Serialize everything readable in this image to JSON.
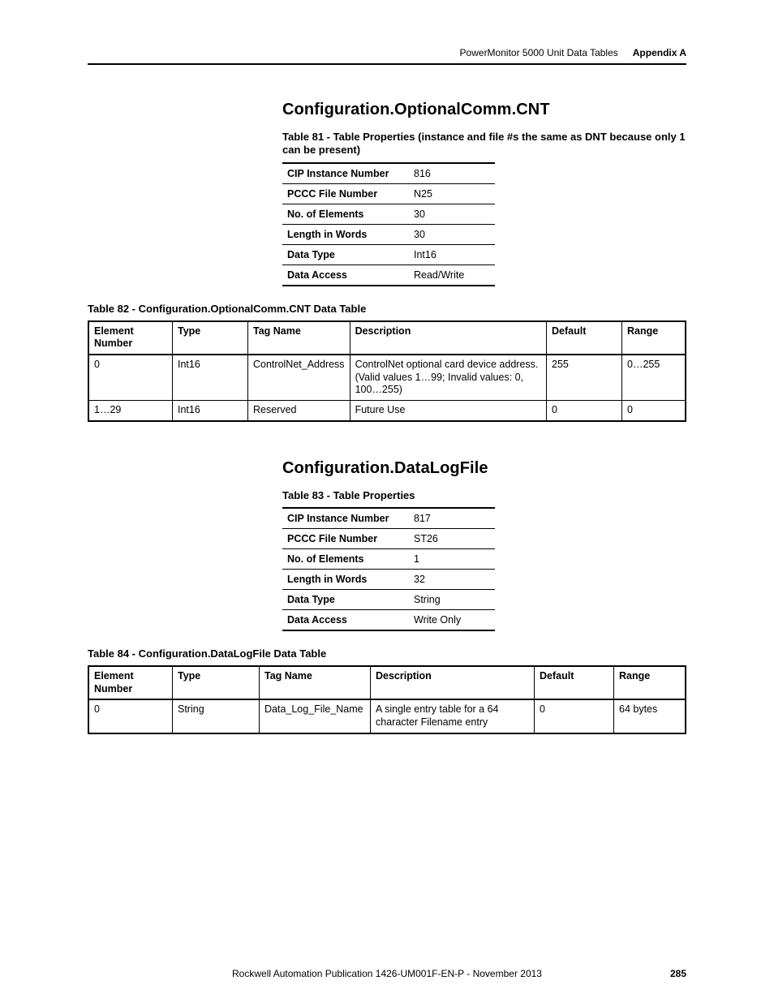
{
  "running_head": {
    "title": "PowerMonitor 5000 Unit Data Tables",
    "appendix": "Appendix A"
  },
  "section1": {
    "title": "Configuration.OptionalComm.CNT",
    "props_caption": "Table 81 - Table Properties (instance and file #s the same as DNT because only 1 can be present)",
    "props": [
      {
        "label": "CIP Instance Number",
        "value": "816"
      },
      {
        "label": "PCCC File Number",
        "value": "N25"
      },
      {
        "label": "No. of Elements",
        "value": "30"
      },
      {
        "label": "Length in Words",
        "value": "30"
      },
      {
        "label": "Data Type",
        "value": "Int16"
      },
      {
        "label": "Data Access",
        "value": "Read/Write"
      }
    ],
    "data_caption": "Table 82 - Configuration.OptionalComm.CNT Data Table",
    "data_headers": {
      "elem": "Element Number",
      "type": "Type",
      "tag": "Tag Name",
      "desc": "Description",
      "def": "Default",
      "range": "Range"
    },
    "rows": [
      {
        "elem": "0",
        "type": "Int16",
        "tag": "ControlNet_Address",
        "desc": "ControlNet optional card device address. (Valid values 1…99; Invalid values: 0, 100…255)",
        "def": "255",
        "range": "0…255"
      },
      {
        "elem": "1…29",
        "type": "Int16",
        "tag": "Reserved",
        "desc": "Future Use",
        "def": "0",
        "range": "0"
      }
    ]
  },
  "section2": {
    "title": "Configuration.DataLogFile",
    "props_caption": "Table 83 - Table Properties",
    "props": [
      {
        "label": "CIP Instance Number",
        "value": "817"
      },
      {
        "label": "PCCC File Number",
        "value": "ST26"
      },
      {
        "label": "No. of Elements",
        "value": "1"
      },
      {
        "label": "Length in Words",
        "value": "32"
      },
      {
        "label": "Data Type",
        "value": "String"
      },
      {
        "label": "Data Access",
        "value": "Write Only"
      }
    ],
    "data_caption": "Table 84 - Configuration.DataLogFile Data Table",
    "data_headers": {
      "elem": "Element Number",
      "type": "Type",
      "tag": "Tag Name",
      "desc": "Description",
      "def": "Default",
      "range": "Range"
    },
    "rows": [
      {
        "elem": "0",
        "type": "String",
        "tag": "Data_Log_File_Name",
        "desc": "A single entry table for a 64 character Filename entry",
        "def": "0",
        "range": "64 bytes"
      }
    ]
  },
  "footer": {
    "publication": "Rockwell Automation Publication 1426-UM001F-EN-P - November 2013",
    "page": "285"
  }
}
